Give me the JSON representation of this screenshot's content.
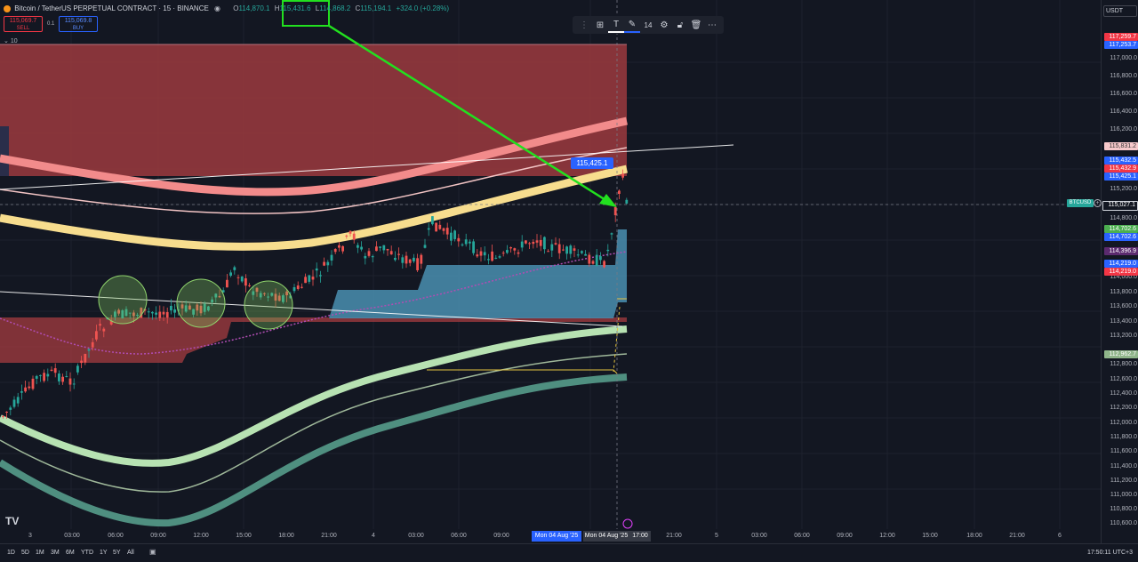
{
  "header": {
    "symbol_title": "Bitcoin / TetherUS PERPETUAL CONTRACT · 15 · BINANCE",
    "ohlc": {
      "o_label": "O",
      "o": "114,870.1",
      "h_label": "H",
      "h": "115,431.6",
      "l_label": "L",
      "l": "114,868.2",
      "c_label": "C",
      "c": "115,194.1",
      "change": "+324.0 (+0.28%)"
    },
    "sell_price": "115,069.7",
    "sell_label": "SELL",
    "spread": "0.1",
    "buy_price": "115,069.8",
    "buy_label": "BUY",
    "indicator_count": "10"
  },
  "drawing_toolbar": {
    "font_size": "14"
  },
  "currency_select": "USDT",
  "price_axis": {
    "ticks": [
      "117,000.0",
      "116,800.0",
      "116,600.0",
      "116,400.0",
      "116,200.0",
      "116,000.0",
      "115,200.0",
      "114,800.0",
      "114,000.0",
      "113,800.0",
      "113,600.0",
      "113,400.0",
      "113,200.0",
      "112,800.0",
      "112,600.0",
      "112,400.0",
      "112,200.0",
      "112,000.0",
      "111,800.0",
      "111,600.0",
      "111,400.0",
      "111,200.0",
      "111,000.0",
      "110,800.0",
      "110,600.0"
    ],
    "labels": [
      {
        "text": "117,259.7",
        "color": "#f23645"
      },
      {
        "text": "117,253.7",
        "color": "#2962ff"
      },
      {
        "text": "115,831.2",
        "color": "#f7c9cb"
      },
      {
        "text": "115,432.5",
        "color": "#2962ff"
      },
      {
        "text": "115,432.9",
        "color": "#f23645"
      },
      {
        "text": "115,425.1",
        "color": "#2962ff"
      },
      {
        "text": "115,027.1",
        "color": "#131722"
      },
      {
        "text": "114,702.6",
        "color": "#4caf50"
      },
      {
        "text": "114,702.6",
        "color": "#2962ff"
      },
      {
        "text": "114,396.9",
        "color": "#5b2a6e"
      },
      {
        "text": "114,219.0",
        "color": "#2962ff"
      },
      {
        "text": "114,219.0",
        "color": "#f23645"
      },
      {
        "text": "112,962.7",
        "color": "#8fb58a"
      }
    ]
  },
  "crosshair_symbol": "BTCUSD",
  "price_callout": "115,425.1",
  "time_axis": {
    "ticks": [
      "3",
      "03:00",
      "06:00",
      "09:00",
      "12:00",
      "15:00",
      "18:00",
      "21:00",
      "4",
      "03:00",
      "06:00",
      "09:00",
      "21:00",
      "5",
      "03:00",
      "06:00",
      "09:00",
      "12:00",
      "15:00",
      "18:00",
      "21:00",
      "6"
    ],
    "highlight_1": "Mon 04 Aug '25",
    "highlight_2": "Mon 04 Aug '25",
    "highlight_time": "17:00"
  },
  "bottom_bar": {
    "ranges": [
      "1D",
      "5D",
      "1M",
      "3M",
      "6M",
      "YTD",
      "1Y",
      "5Y",
      "All"
    ],
    "clock": "17:50:11 UTC+3"
  },
  "colors": {
    "up": "#26a69a",
    "down": "#ef5350",
    "arrow": "#22e01f",
    "bg": "#131722"
  }
}
